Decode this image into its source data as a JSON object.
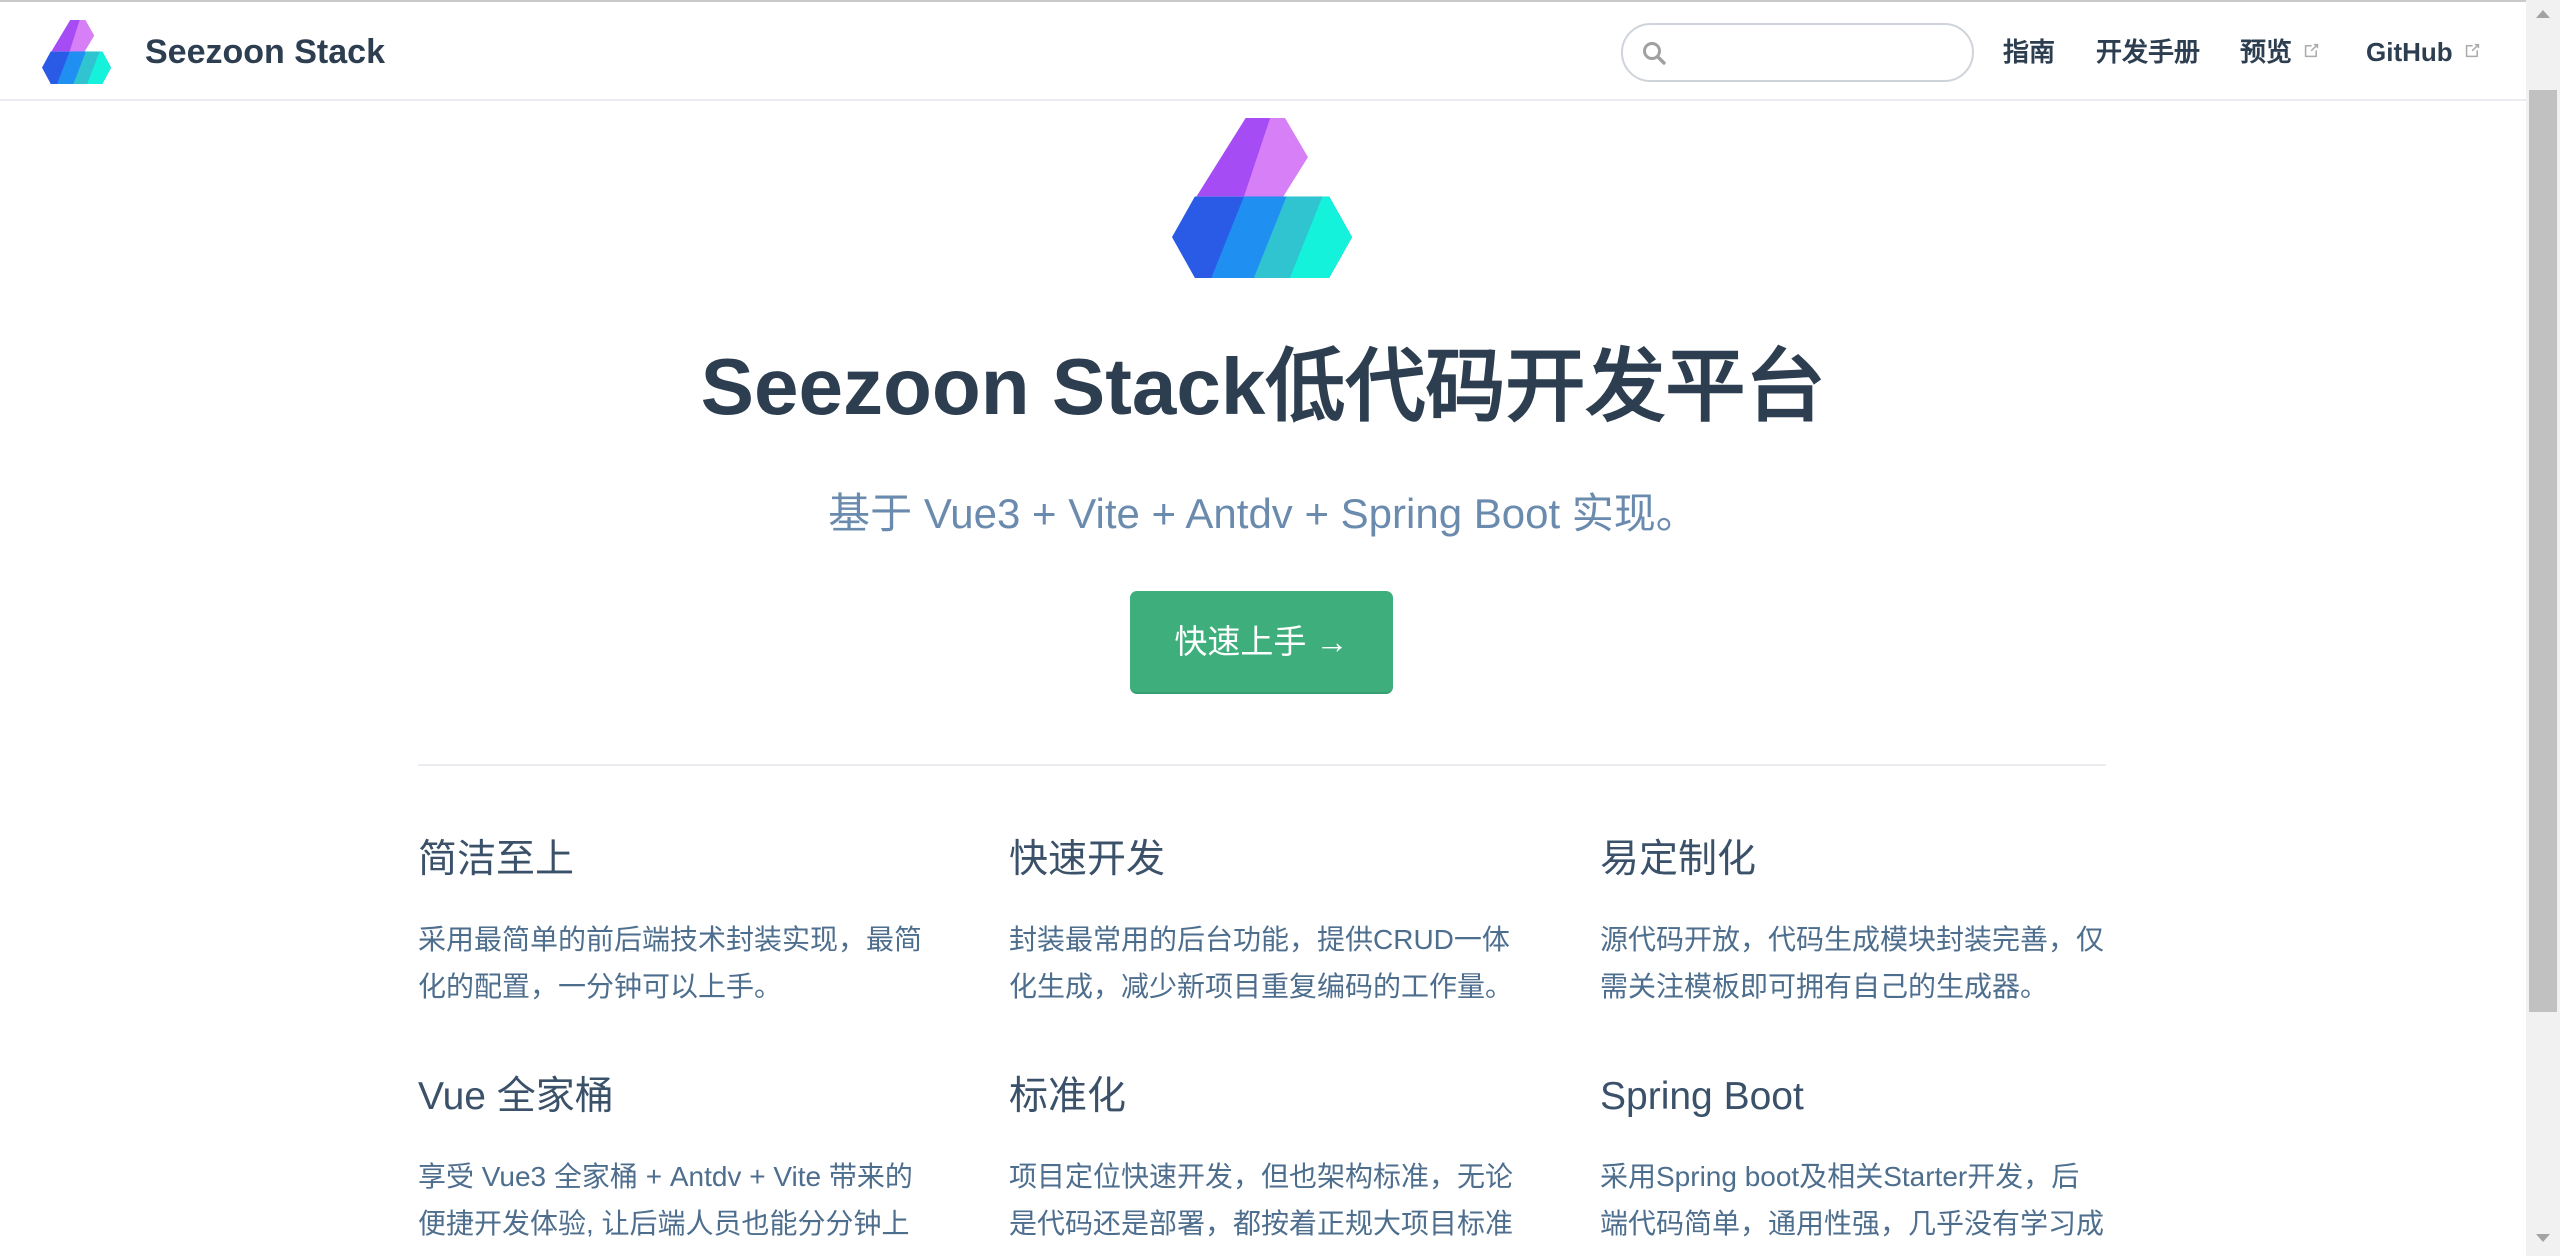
{
  "navbar": {
    "brand": "Seezoon Stack",
    "search": {
      "value": ""
    },
    "links": [
      {
        "label": "指南",
        "external": false
      },
      {
        "label": "开发手册",
        "external": false
      },
      {
        "label": "预览",
        "external": true
      },
      {
        "label": "GitHub",
        "external": true
      }
    ]
  },
  "hero": {
    "title": "Seezoon Stack低代码开发平台",
    "description": "基于 Vue3 + Vite + Antdv + Spring Boot 实现。",
    "action_label": "快速上手 →"
  },
  "features": [
    {
      "title": "简洁至上",
      "lines": [
        "采用最简单的前后端技术封装实现，最简",
        "化的配置，一分钟可以上手。"
      ]
    },
    {
      "title": "快速开发",
      "lines": [
        "封装最常用的后台功能，提供CRUD一体",
        "化生成，减少新项目重复编码的工作量。"
      ]
    },
    {
      "title": "易定制化",
      "lines": [
        "源代码开放，代码生成模块封装完善，仅",
        "需关注模板即可拥有自己的生成器。"
      ]
    },
    {
      "title": "Vue 全家桶",
      "lines": [
        "享受 Vue3 全家桶 + Antdv + Vite 带来的",
        "便捷开发体验, 让后端人员也能分分钟上"
      ]
    },
    {
      "title": "标准化",
      "lines": [
        "项目定位快速开发，但也架构标准，无论",
        "是代码还是部署，都按着正规大项目标准"
      ]
    },
    {
      "title": "Spring Boot",
      "lines": [
        "采用Spring boot及相关Starter开发，后",
        "端代码简单，通用性强，几乎没有学习成"
      ]
    }
  ],
  "icons": {
    "logo": "logo-icon",
    "search": "search-icon",
    "external": "external-link-icon",
    "scroll_up": "scroll-up-arrow-icon",
    "scroll_down": "scroll-down-arrow-icon"
  },
  "colors": {
    "accent": "#3eaf7c",
    "text": "#2c3e50",
    "subtitle": "#6a8bad",
    "feature_title": "#3a5169",
    "feature_text": "#4e6e8e",
    "logo_purple": "#a64cf5",
    "logo_pink": "#d67ff6",
    "logo_blue": "#2a5be6",
    "logo_cyan": "#14f2dc"
  }
}
